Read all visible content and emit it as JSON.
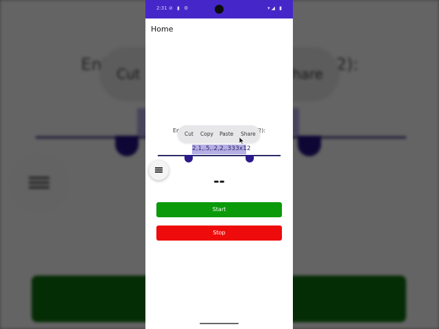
{
  "background": {
    "blur_title_left": "Ent",
    "blur_title_right": "2):",
    "blur_cut": "Cut",
    "blur_share": "hare"
  },
  "status_bar": {
    "time": "2:31",
    "left_icons": "⊘ ▮ ⚙",
    "right_icons": "▾◢ ▮"
  },
  "app": {
    "title": "Home",
    "prompt_start": "En",
    "prompt_end": "2):",
    "input_value_selected": "2,1,.5,.2,2,.333x12",
    "display_value": "--",
    "start_label": "Start",
    "stop_label": "Stop"
  },
  "context_menu": {
    "cut": "Cut",
    "copy": "Copy",
    "paste": "Paste",
    "share": "Share"
  },
  "colors": {
    "status_bar": "#4527c9",
    "start": "#0a9a0a",
    "stop": "#ee0b0b",
    "selection": "#b4aee4",
    "handles": "#2a1a8a"
  }
}
